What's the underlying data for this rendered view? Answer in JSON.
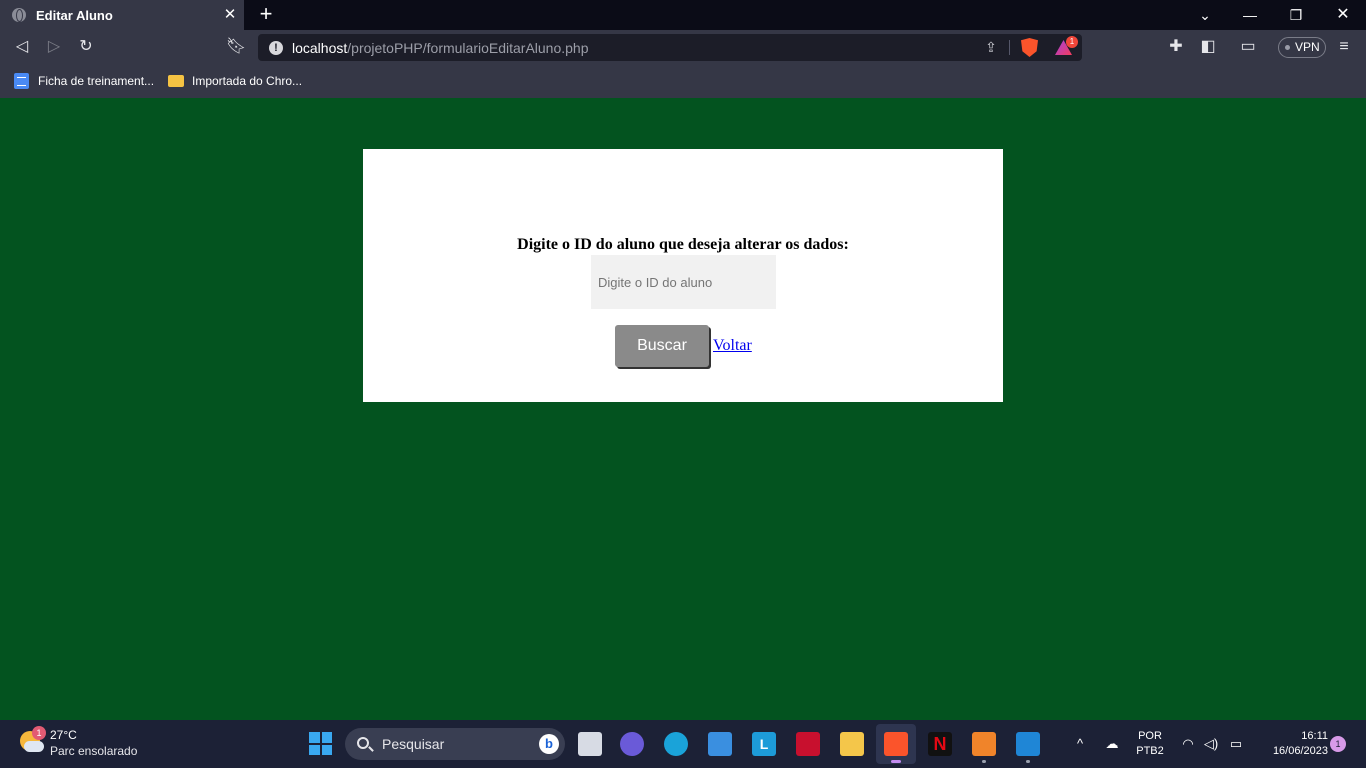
{
  "browser": {
    "tab_title": "Editar Aluno",
    "tab_close_icon": "close-icon",
    "new_tab_symbol": "+",
    "url_host": "localhost",
    "url_path": "/projetoPHP/formularioEditarAluno.php",
    "rewards_badge": "1",
    "vpn_label": "VPN",
    "bookmarks": [
      {
        "label": "Ficha de treinament...",
        "icon": "document-icon"
      },
      {
        "label": "Importada do Chro...",
        "icon": "folder-icon"
      }
    ]
  },
  "form": {
    "prompt": "Digite o ID do aluno que deseja alterar os dados:",
    "id_placeholder": "Digite o ID do aluno",
    "id_value": "",
    "buscar_label": "Buscar",
    "voltar_label": "Voltar"
  },
  "taskbar": {
    "weather_badge": "1",
    "temperature": "27°C",
    "weather_desc": "Parc ensolarado",
    "search_label": "Pesquisar",
    "lang_top": "POR",
    "lang_bottom": "PTB2",
    "time": "16:11",
    "date": "16/06/2023",
    "notification_count": "1"
  },
  "colors": {
    "page_background": "#03531f",
    "browser_chrome": "#353746",
    "button_gray": "#8a8a8a",
    "link_blue": "#0000ee"
  }
}
